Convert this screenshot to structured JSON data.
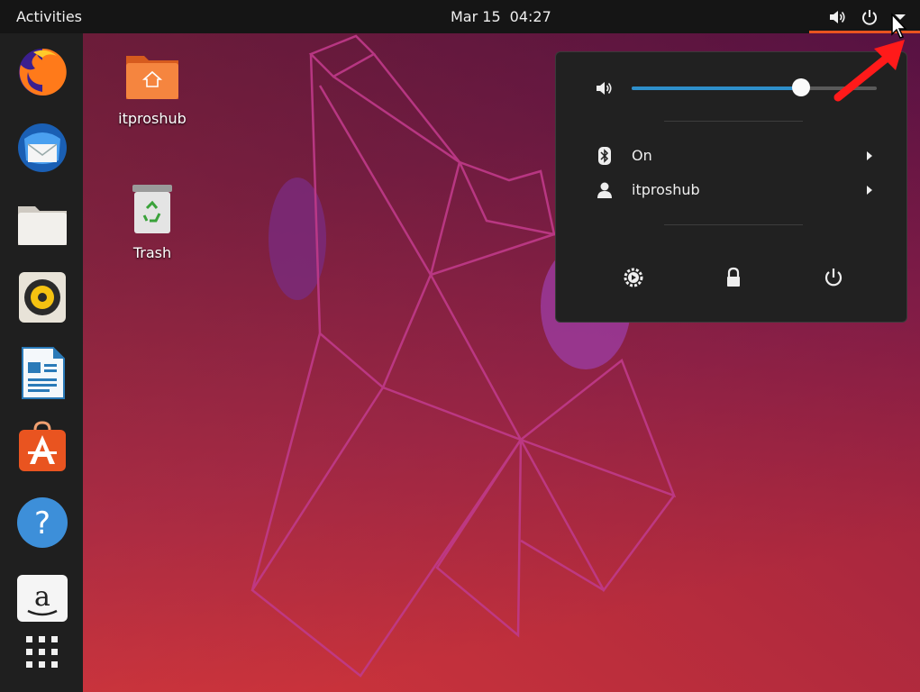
{
  "topbar": {
    "activities_label": "Activities",
    "date": "Mar 15",
    "time": "04:27",
    "tray_icons": [
      "volume-icon",
      "power-icon",
      "dropdown-arrow-icon"
    ]
  },
  "dock": {
    "items": [
      {
        "name": "firefox-icon"
      },
      {
        "name": "thunderbird-icon"
      },
      {
        "name": "files-icon"
      },
      {
        "name": "rhythmbox-icon"
      },
      {
        "name": "libreoffice-writer-icon"
      },
      {
        "name": "ubuntu-software-icon"
      },
      {
        "name": "help-icon"
      },
      {
        "name": "amazon-icon"
      },
      {
        "name": "show-applications-icon"
      }
    ]
  },
  "desktop": {
    "home_folder_label": "itproshub",
    "trash_label": "Trash"
  },
  "system_menu": {
    "volume_level": 0.69,
    "bluetooth": {
      "label": "On",
      "icon": "bluetooth-icon"
    },
    "user": {
      "label": "itproshub",
      "icon": "user-icon"
    },
    "buttons": [
      "settings-icon",
      "lock-icon",
      "power-off-icon"
    ]
  },
  "colors": {
    "accent_orange": "#e95420",
    "slider_blue": "#2e8fcb",
    "panel_bg": "#212121",
    "annotation_red": "#ff1a1a"
  }
}
